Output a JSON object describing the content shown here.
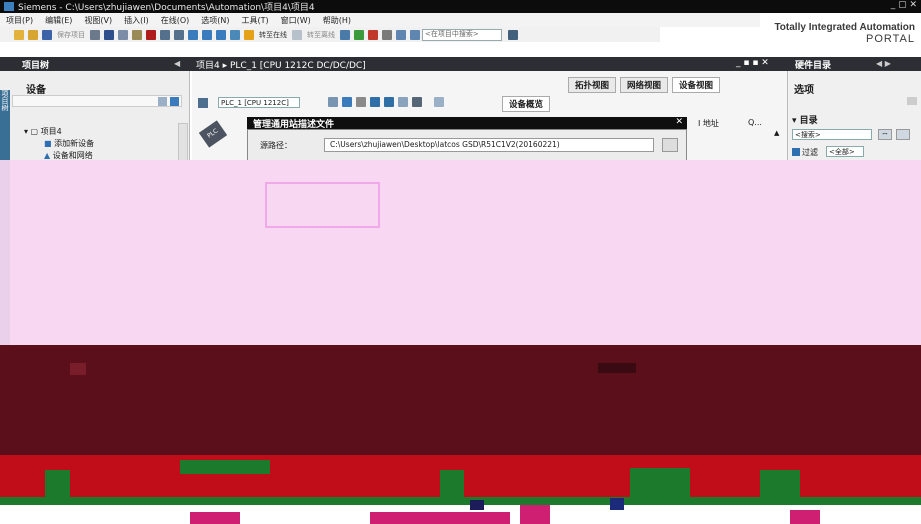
{
  "window": {
    "title": "Siemens  -  C:\\Users\\zhujiawen\\Documents\\Automation\\项目4\\项目4",
    "controls": "_ ▢ ✕"
  },
  "menubar": {
    "items": [
      "项目(P)",
      "编辑(E)",
      "视图(V)",
      "插入(I)",
      "在线(O)",
      "选项(N)",
      "工具(T)",
      "窗口(W)",
      "帮助(H)"
    ]
  },
  "brand": {
    "line1": "Totally Integrated Automation",
    "line2": "PORTAL"
  },
  "toolbar": {
    "save_label": "保存项目",
    "go_online": "转至在线",
    "go_offline": "转至离线",
    "search_placeholder": "<在项目中搜索>"
  },
  "project_tree": {
    "header": "项目树",
    "devices_title": "设备",
    "items": [
      {
        "label": "项目4"
      },
      {
        "label": "添加新设备"
      },
      {
        "label": "设备和网络"
      }
    ],
    "side_tab": "项目树"
  },
  "center": {
    "breadcrumb": "项目4  ▸  PLC_1 [CPU 1212C DC/DC/DC]",
    "views": {
      "topology": "拓扑视图",
      "network": "网络视图",
      "device": "设备视图"
    },
    "device_selector": "PLC_1 [CPU 1212C]",
    "overview_tab": "设备概览",
    "columns": {
      "address": "I 地址",
      "q": "Q..."
    },
    "plc_badge": "PLC"
  },
  "dialog": {
    "title": "管理通用站描述文件",
    "source_label": "源路径：",
    "source_path": "C:\\Users\\zhujiawen\\Desktop\\latcos GSD\\R51C1V2(20160221)"
  },
  "catalog": {
    "header": "硬件目录",
    "options_title": "选项",
    "catalog_title": "目录",
    "search_placeholder": "<搜索>",
    "filter_label": "过滤",
    "filter_value": "<全部>"
  },
  "colors": {
    "header_dark": "#2b2f33",
    "corrupt_pink": "#f7d7f2",
    "corrupt_maroon": "#5a0f1a",
    "corrupt_red": "#c10d1a",
    "corrupt_green": "#1b7a2c"
  }
}
